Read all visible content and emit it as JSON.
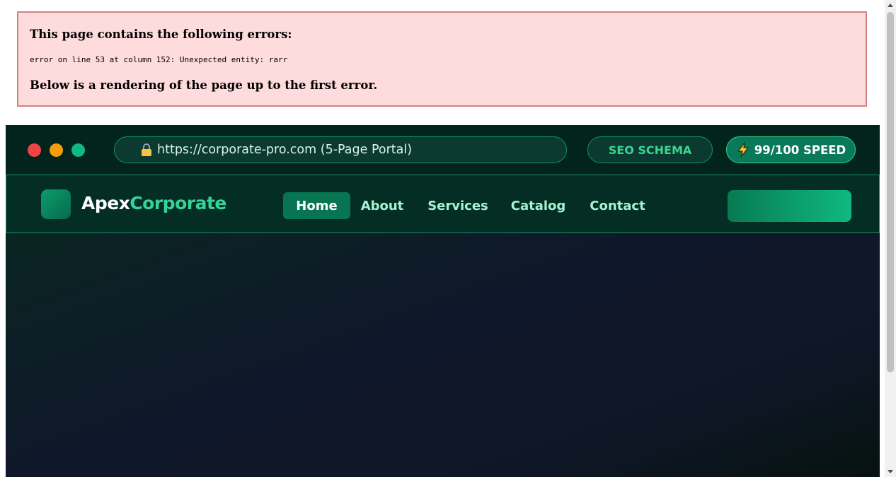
{
  "error": {
    "title": "This page contains the following errors:",
    "detail": "error on line 53 at column 152: Unexpected entity: rarr",
    "below": "Below is a rendering of the page up to the first error."
  },
  "browser": {
    "url": "https://corporate-pro.com (5-Page Portal)",
    "seo_badge": "SEO SCHEMA",
    "speed_badge": "99/100 SPEED",
    "colors": {
      "close": "#ef4444",
      "minimize": "#f59e0b",
      "maximize": "#10b981"
    }
  },
  "header": {
    "logo_part1": "Apex",
    "logo_part2": "Corporate",
    "nav": [
      {
        "label": "Home",
        "active": true
      },
      {
        "label": "About",
        "active": false
      },
      {
        "label": "Services",
        "active": false
      },
      {
        "label": "Catalog",
        "active": false
      },
      {
        "label": "Contact",
        "active": false
      }
    ]
  },
  "colors": {
    "accent": "#34d399",
    "brand_dark": "#03241d",
    "error_bg": "#fedbdc",
    "error_border": "#d08382"
  }
}
